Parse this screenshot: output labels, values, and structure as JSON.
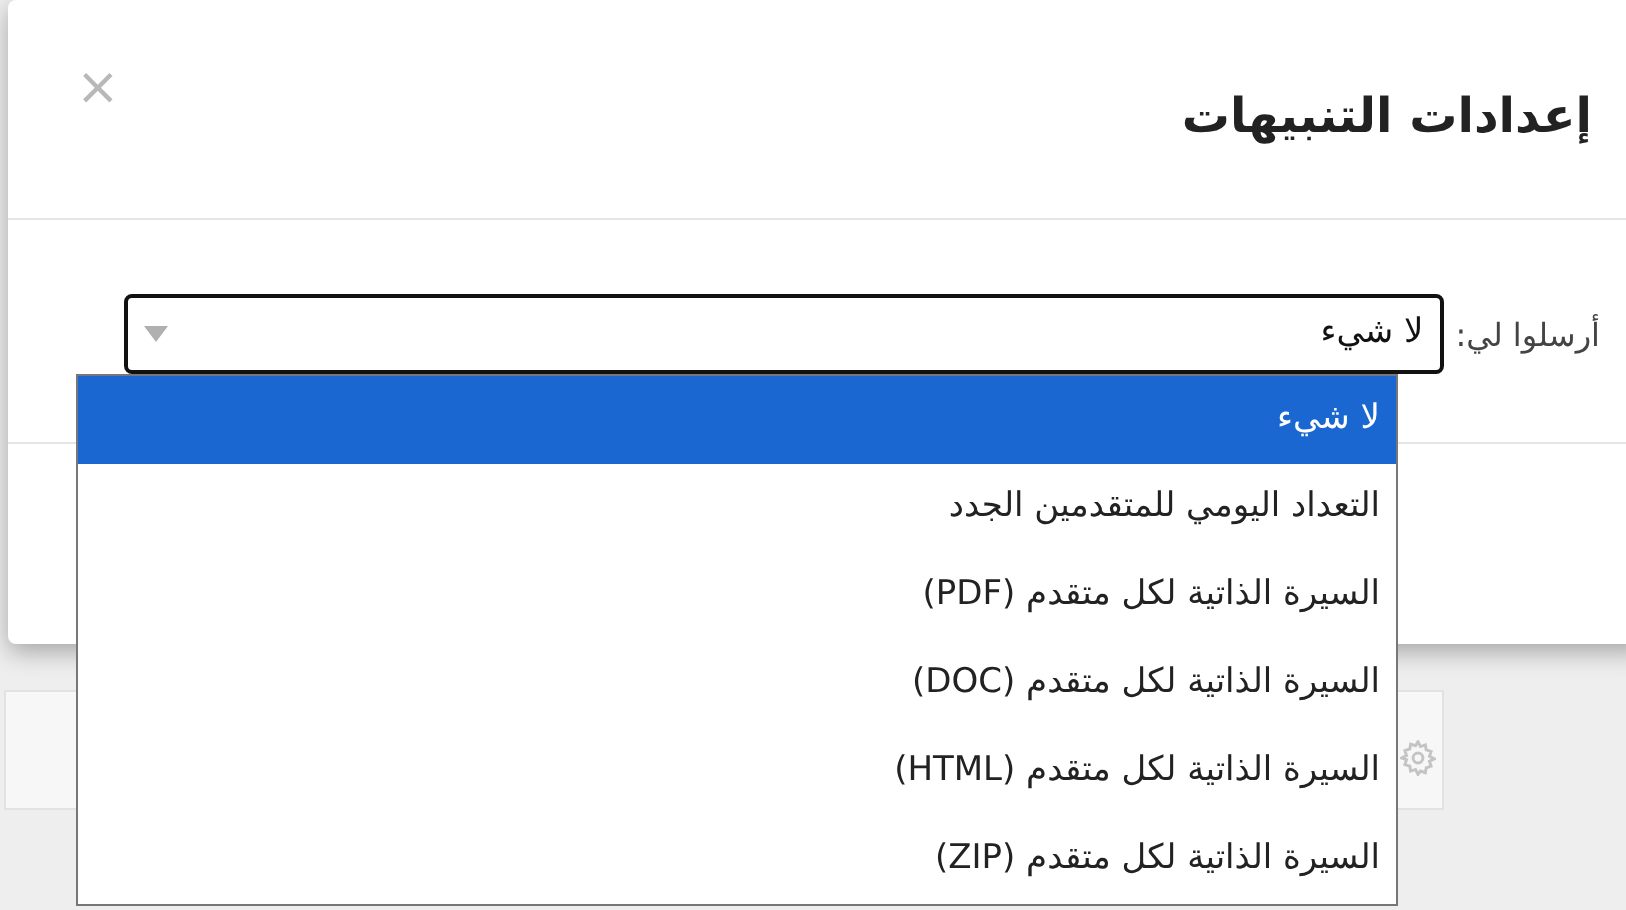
{
  "dialog": {
    "title": "إعدادات التنبيهات",
    "close": "×"
  },
  "field": {
    "label": "أرسلوا لي:",
    "value": "لا شيء",
    "expanded": true
  },
  "options": [
    {
      "label": "لا شيء",
      "selected": true
    },
    {
      "label": "التعداد اليومي للمتقدمين الجدد",
      "selected": false
    },
    {
      "label": "السيرة الذاتية لكل متقدم (PDF)",
      "selected": false
    },
    {
      "label": "السيرة الذاتية لكل متقدم (DOC)",
      "selected": false
    },
    {
      "label": "السيرة الذاتية لكل متقدم (HTML)",
      "selected": false
    },
    {
      "label": "السيرة الذاتية لكل متقدم (ZIP)",
      "selected": false
    }
  ]
}
